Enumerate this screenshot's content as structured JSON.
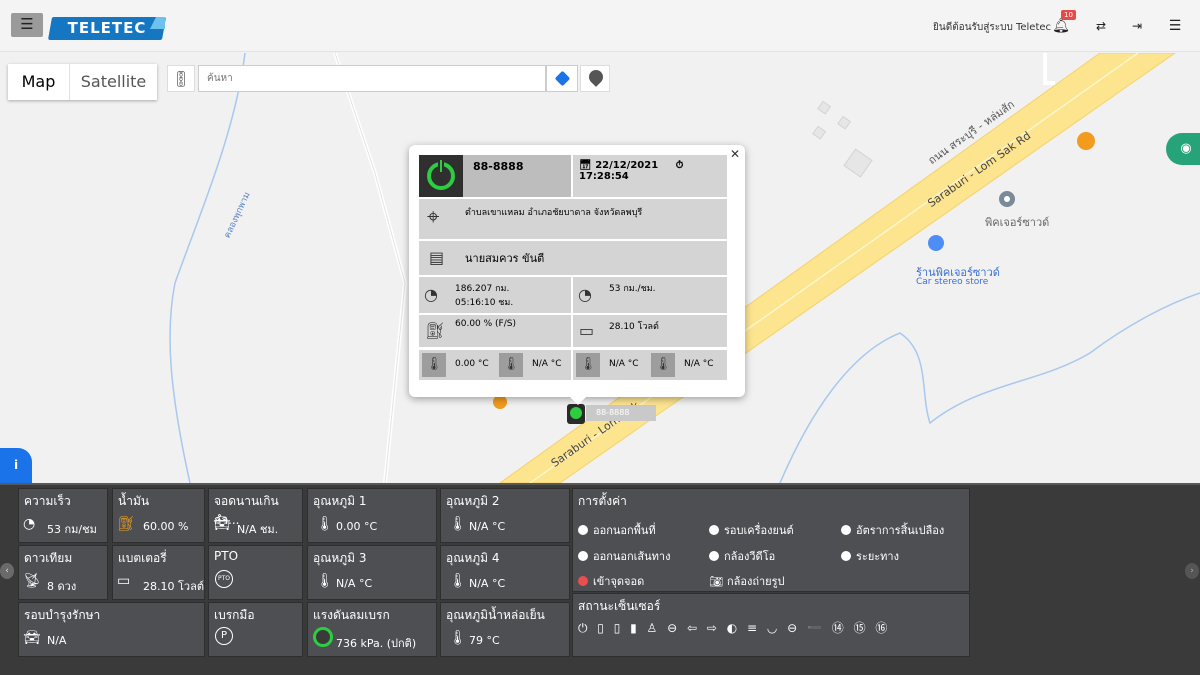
{
  "header": {
    "menu_icon": "hamburger-icon",
    "logo_text": "TELETEC",
    "welcome": "ยินดีต้อนรับสู่ระบบ Teletec",
    "notifications_count": "10"
  },
  "map": {
    "type_map": "Map",
    "type_satellite": "Satellite",
    "search_placeholder": "ค้นหา",
    "labels": {
      "road1": "ถนน สระบุรี - หล่มสัก",
      "road2": "Saraburi - Lom Sak Rd",
      "road3": "Saraburi - Lom Sak",
      "canal": "คลองพุกพาม",
      "poi1": "พิคเจอร์ซาวด์",
      "poi2_name": "ร้านพิคเจอร์ซาวด์",
      "poi2_sub": "Car stereo store"
    },
    "marker_label": "88-8888"
  },
  "popup": {
    "plate": "88-8888",
    "date": "22/12/2021",
    "time": "17:28:54",
    "location": "ตำบลเขาแหลม อำเภอชัยบาดาล จังหวัดลพบุรี",
    "driver": "นายสมควร ขันตี",
    "odometer": "186.207  กม.",
    "engine_hours": "05:16:10  ชม.",
    "speed": "53  กม./ชม.",
    "fuel": "60.00  % (F/S)",
    "battery": "28.10  โวลต์",
    "temp1": "0.00  °C",
    "temp2": "N/A  °C",
    "temp3": "N/A  °C",
    "temp4": "N/A  °C"
  },
  "dashboard": {
    "speed": {
      "title": "ความเร็ว",
      "value": "53 กม/ชม"
    },
    "fuel": {
      "title": "น้ำมัน",
      "value": "60.00 %"
    },
    "idle": {
      "title": "จอดนานเกินกำ...",
      "value": "N/A ชม."
    },
    "temp1": {
      "title": "อุณหภูมิ 1",
      "value": "0.00 °C"
    },
    "temp2": {
      "title": "อุณหภูมิ 2",
      "value": "N/A °C"
    },
    "gps": {
      "title": "ดาวเทียม",
      "value": "8 ดวง"
    },
    "battery": {
      "title": "แบตเตอรี่",
      "value": "28.10 โวลต์"
    },
    "pto": {
      "title": "PTO",
      "value": ""
    },
    "temp3": {
      "title": "อุณหภูมิ 3",
      "value": "N/A °C"
    },
    "temp4": {
      "title": "อุณหภูมิ 4",
      "value": "N/A °C"
    },
    "maintenance": {
      "title": "รอบบำรุงรักษา",
      "value": "N/A"
    },
    "handbrake": {
      "title": "เบรกมือ",
      "value": ""
    },
    "air_pressure": {
      "title": "แรงดันลมเบรก",
      "value": "736 kPa. (ปกติ)"
    },
    "coolant": {
      "title": "อุณหภูมิน้ำหล่อเย็น",
      "value": "79 °C"
    },
    "settings": {
      "title": "การตั้งค่า",
      "opt1": "ออกนอกพื้นที่",
      "opt2": "รอบเครื่องยนต์",
      "opt3": "อัตราการสิ้นเปลือง",
      "opt4": "ออกนอกเส้นทาง",
      "opt5": "กล้องวีดีโอ",
      "opt6": "ระยะทาง",
      "opt7": "เข้าจุดจอด",
      "opt8": "กล้องถ่ายรูป"
    },
    "sensors": {
      "title": "สถานะเซ็นเซอร์",
      "icons": "⏻ ▯ ▯ ▮ ♙ ⊖ ⇦ ⇨ ◐ ≡ ◡ ⊖ ➖ ⑭ ⑮ ⑯"
    }
  }
}
